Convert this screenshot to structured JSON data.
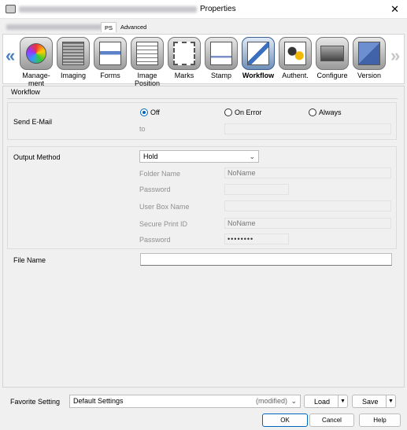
{
  "window": {
    "title": "Properties",
    "close_icon": "close-icon"
  },
  "tabs": [
    {
      "label": "PS"
    },
    {
      "label": "Advanced"
    }
  ],
  "toolbar": {
    "items": [
      {
        "label": "Manage-\nment"
      },
      {
        "label": "Imaging"
      },
      {
        "label": "Forms"
      },
      {
        "label": "Image\nPosition"
      },
      {
        "label": "Marks"
      },
      {
        "label": "Stamp"
      },
      {
        "label": "Workflow"
      },
      {
        "label": "Authent."
      },
      {
        "label": "Configure"
      },
      {
        "label": "Version"
      }
    ]
  },
  "panel": {
    "heading": "Workflow",
    "send_email": {
      "label": "Send E-Mail",
      "options": [
        "Off",
        "On Error",
        "Always"
      ],
      "selected": "Off",
      "to_label": "to",
      "to_value": ""
    },
    "output_method": {
      "label": "Output Method",
      "value": "Hold",
      "folder_name_label": "Folder Name",
      "folder_name_value": "NoName",
      "password_label": "Password",
      "user_box_label": "User Box Name",
      "secure_id_label": "Secure Print ID",
      "secure_id_value": "NoName",
      "password2_label": "Password",
      "password2_value": "••••••••"
    },
    "file_name": {
      "label": "File Name",
      "value": ""
    }
  },
  "footer": {
    "favorite_label": "Favorite Setting",
    "favorite_value": "Default Settings",
    "favorite_state": "(modified)",
    "load": "Load",
    "save": "Save",
    "ok": "OK",
    "cancel": "Cancel",
    "help": "Help"
  }
}
